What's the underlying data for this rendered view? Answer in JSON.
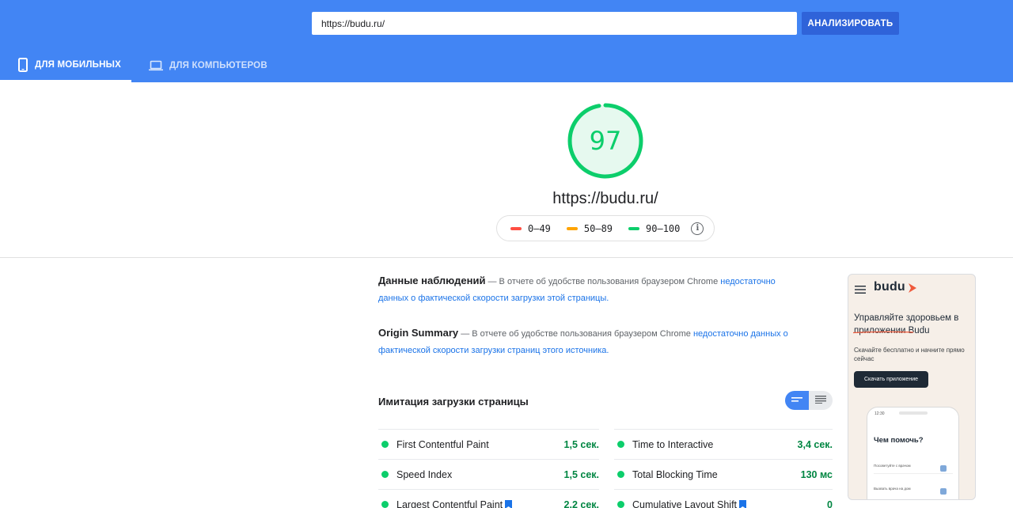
{
  "header": {
    "url_value": "https://budu.ru/",
    "analyze_label": "АНАЛИЗИРОВАТЬ",
    "tabs": [
      {
        "label": "ДЛЯ МОБИЛЬНЫХ",
        "icon": "smartphone-icon",
        "active": true
      },
      {
        "label": "ДЛЯ КОМПЬЮТЕРОВ",
        "icon": "laptop-icon",
        "active": false
      }
    ]
  },
  "score": {
    "value": "97",
    "fraction": 0.97,
    "url": "https://budu.ru/",
    "legend": [
      {
        "label": "0–49",
        "color": "#ff4e42"
      },
      {
        "label": "50–89",
        "color": "#ffa400"
      },
      {
        "label": "90–100",
        "color": "#0cce6b"
      }
    ],
    "info_glyph": "i"
  },
  "field_data": {
    "title": "Данные наблюдений",
    "text": " — В отчете об удобстве пользования браузером Chrome ",
    "link": "недостаточно данных о фактической скорости загрузки этой страницы."
  },
  "origin_summary": {
    "title": "Origin Summary",
    "text": " — В отчете об удобстве пользования браузером Chrome ",
    "link": "недостаточно данных о фактической скорости загрузки страниц этого источника."
  },
  "lab": {
    "title": "Имитация загрузки страницы",
    "metrics_left": [
      {
        "name": "First Contentful Paint",
        "value": "1,5 сек.",
        "flag": false
      },
      {
        "name": "Speed Index",
        "value": "1,5 сек.",
        "flag": false
      },
      {
        "name": "Largest Contentful Paint",
        "value": "2,2 сек.",
        "flag": true
      }
    ],
    "metrics_right": [
      {
        "name": "Time to Interactive",
        "value": "3,4 сек.",
        "flag": false
      },
      {
        "name": "Total Blocking Time",
        "value": "130 мс",
        "flag": false
      },
      {
        "name": "Cumulative Layout Shift",
        "value": "0",
        "flag": true
      }
    ]
  },
  "thumbnail": {
    "logo": "budu",
    "headline": "Управляйте здоровьем в приложении Budu",
    "subtitle": "Скачайте бесплатно и начните прямо сейчас",
    "button": "Скачать приложение",
    "phone_time": "12:30",
    "phone_title": "Чем помочь?",
    "row1": "Посоветуйте с врачом",
    "row2": "Вызвать врача на дом"
  },
  "colors": {
    "brand_blue": "#4285f4",
    "button_blue": "#2f63d9",
    "pass_green": "#0cce6b",
    "value_green": "#018642"
  }
}
